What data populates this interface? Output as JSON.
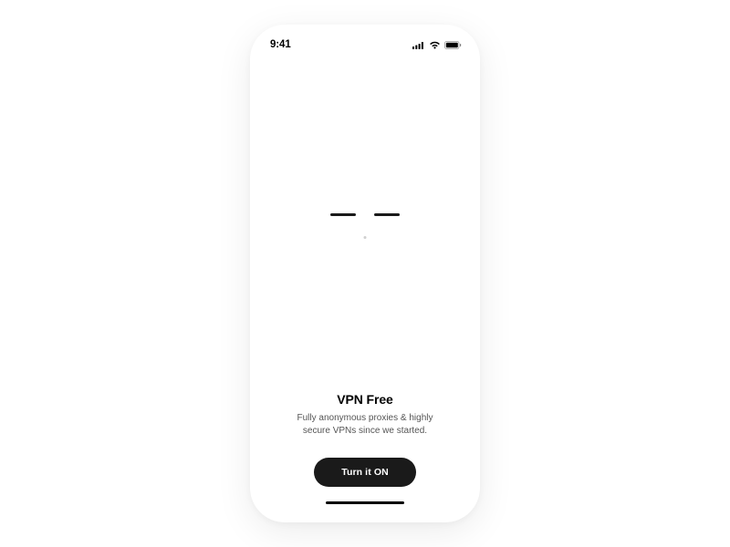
{
  "statusBar": {
    "time": "9:41"
  },
  "content": {
    "title": "VPN Free",
    "subtitle": "Fully anonymous proxies & highly secure VPNs since we started."
  },
  "cta": {
    "label": "Turn it ON"
  }
}
